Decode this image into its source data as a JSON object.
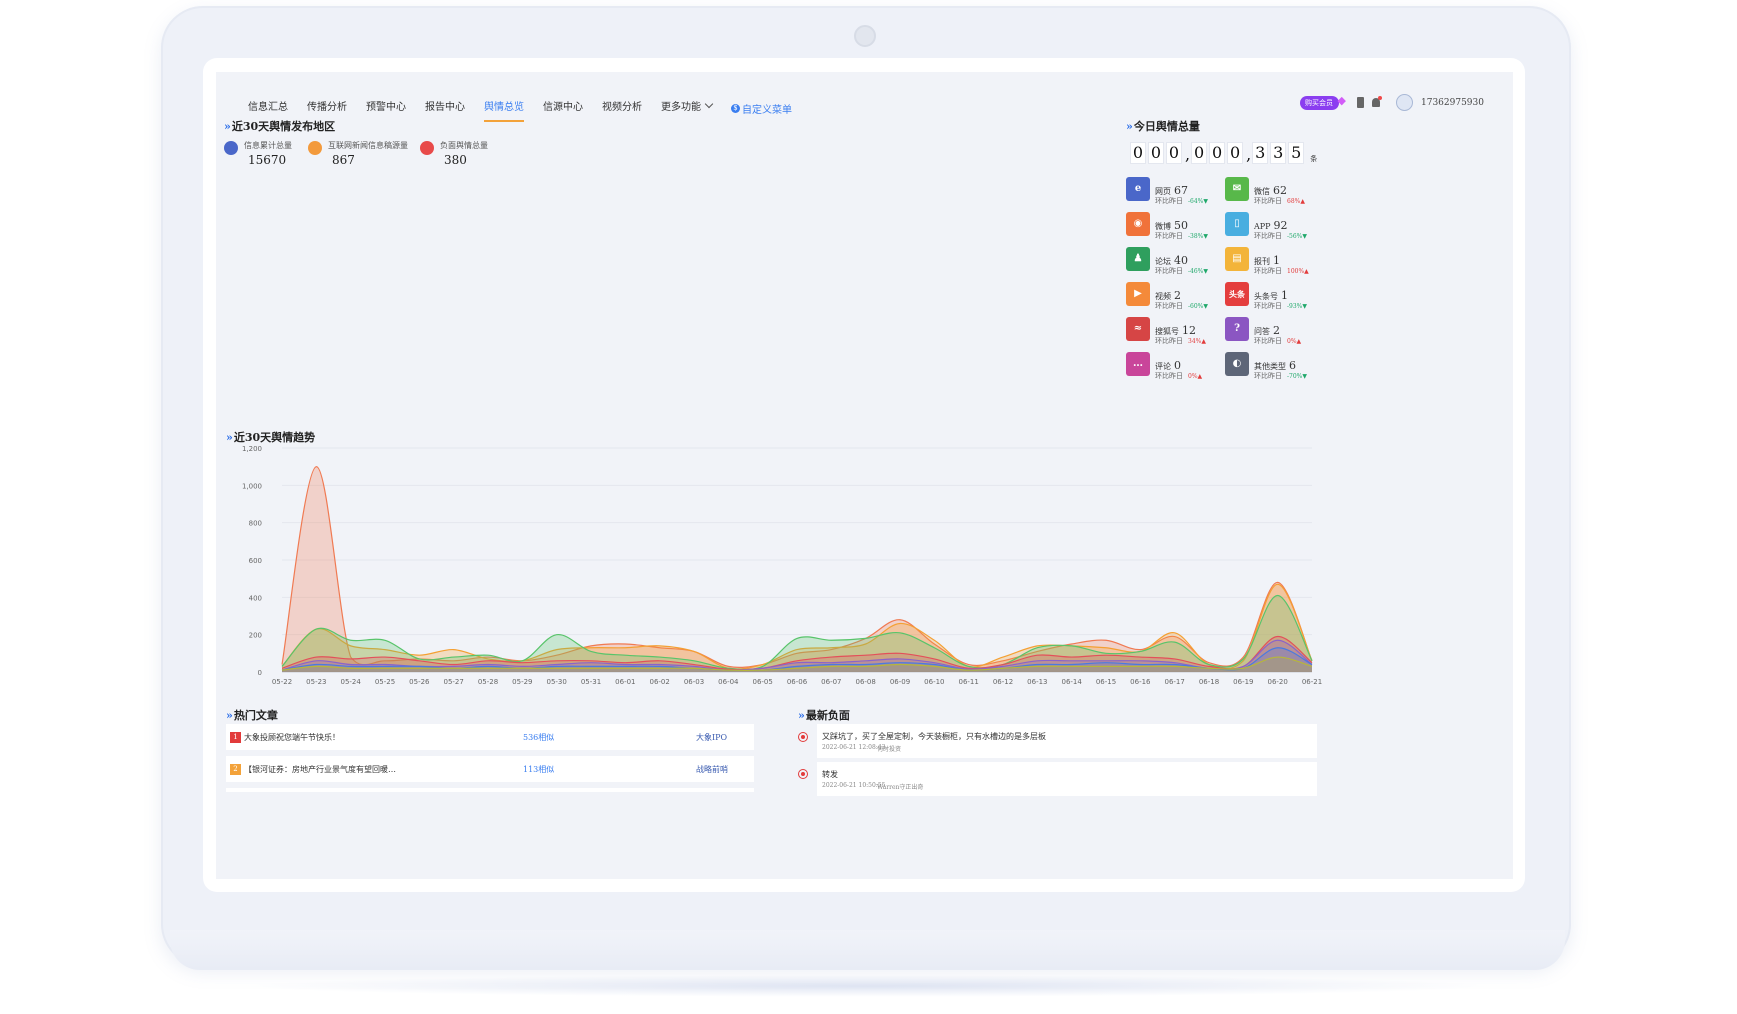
{
  "nav": {
    "items": [
      {
        "label": "信息汇总"
      },
      {
        "label": "传播分析"
      },
      {
        "label": "预警中心"
      },
      {
        "label": "报告中心"
      },
      {
        "label": "舆情总览",
        "active": true
      },
      {
        "label": "信源中心"
      },
      {
        "label": "视频分析"
      },
      {
        "label": "更多功能"
      }
    ],
    "custom_menu": "自定义菜单",
    "custom_menu_icon": "$"
  },
  "topbar": {
    "vip_label": "购买会员",
    "phone": "17362975930"
  },
  "region": {
    "title": "近30天舆情发布地区",
    "stats": [
      {
        "label": "信息累计总量",
        "value": "15670",
        "color": "#4a67c9"
      },
      {
        "label": "互联网新闻信息稿源量",
        "value": "867",
        "color": "#f39a3c"
      },
      {
        "label": "负面舆情总量",
        "value": "380",
        "color": "#e84a4a"
      }
    ]
  },
  "today": {
    "title": "今日舆情总量",
    "digits": [
      "0",
      "0",
      "0",
      ",",
      "0",
      "0",
      "0",
      ",",
      "3",
      "3",
      "5"
    ],
    "unit": "条",
    "compare_label": "环比昨日",
    "media": [
      {
        "name": "网页",
        "count": "67",
        "pct": "-64%",
        "dir": "down",
        "color": "#4a67c9",
        "icon": "e"
      },
      {
        "name": "微信",
        "count": "62",
        "pct": "68%",
        "dir": "up",
        "color": "#58b84a",
        "icon": "✉"
      },
      {
        "name": "微博",
        "count": "50",
        "pct": "-38%",
        "dir": "down",
        "color": "#f0723a",
        "icon": "◉"
      },
      {
        "name": "APP",
        "count": "92",
        "pct": "-56%",
        "dir": "down",
        "color": "#49aee0",
        "icon": "▯"
      },
      {
        "name": "论坛",
        "count": "40",
        "pct": "-46%",
        "dir": "down",
        "color": "#2f9f5e",
        "icon": "♟"
      },
      {
        "name": "报刊",
        "count": "1",
        "pct": "100%",
        "dir": "up",
        "color": "#f3b43a",
        "icon": "▤"
      },
      {
        "name": "视频",
        "count": "2",
        "pct": "-60%",
        "dir": "down",
        "color": "#f48a3a",
        "icon": "▶"
      },
      {
        "name": "头条号",
        "count": "1",
        "pct": "-93%",
        "dir": "down",
        "color": "#e43e3e",
        "icon": "头条"
      },
      {
        "name": "搜狐号",
        "count": "12",
        "pct": "34%",
        "dir": "up",
        "color": "#d64545",
        "icon": "≈"
      },
      {
        "name": "问答",
        "count": "2",
        "pct": "0%",
        "dir": "up",
        "color": "#8b56c2",
        "icon": "?"
      },
      {
        "name": "评论",
        "count": "0",
        "pct": "0%",
        "dir": "up",
        "color": "#c9459a",
        "icon": "…"
      },
      {
        "name": "其他类型",
        "count": "6",
        "pct": "-70%",
        "dir": "down",
        "color": "#5e6678",
        "icon": "◐"
      }
    ]
  },
  "trend": {
    "title": "近30天舆情趋势"
  },
  "chart_data": {
    "type": "area",
    "ylim": [
      0,
      1200
    ],
    "yticks": [
      "0",
      "200",
      "400",
      "600",
      "800",
      "1,000",
      "1,200"
    ],
    "categories": [
      "05-22",
      "05-23",
      "05-24",
      "05-25",
      "05-26",
      "05-27",
      "05-28",
      "05-29",
      "05-30",
      "05-31",
      "06-01",
      "06-02",
      "06-03",
      "06-04",
      "06-05",
      "06-06",
      "06-07",
      "06-08",
      "06-09",
      "06-10",
      "06-11",
      "06-12",
      "06-13",
      "06-14",
      "06-15",
      "06-16",
      "06-17",
      "06-18",
      "06-19",
      "06-20",
      "06-21"
    ],
    "series": [
      {
        "color": "#f07a52",
        "values": [
          40,
          1100,
          80,
          60,
          70,
          60,
          80,
          60,
          90,
          140,
          150,
          130,
          110,
          30,
          40,
          100,
          120,
          180,
          280,
          150,
          40,
          60,
          110,
          150,
          170,
          120,
          190,
          50,
          80,
          480,
          60
        ]
      },
      {
        "color": "#f4a033",
        "values": [
          30,
          230,
          140,
          120,
          90,
          120,
          70,
          60,
          120,
          130,
          130,
          140,
          110,
          20,
          40,
          120,
          130,
          150,
          260,
          170,
          30,
          80,
          140,
          140,
          130,
          110,
          210,
          40,
          60,
          470,
          60
        ]
      },
      {
        "color": "#58c46a",
        "values": [
          30,
          230,
          170,
          170,
          70,
          80,
          90,
          60,
          200,
          110,
          90,
          80,
          60,
          20,
          30,
          180,
          170,
          180,
          210,
          130,
          30,
          40,
          130,
          140,
          100,
          110,
          160,
          40,
          70,
          410,
          60
        ]
      },
      {
        "color": "#e3505a",
        "values": [
          20,
          80,
          70,
          80,
          60,
          40,
          60,
          50,
          60,
          60,
          50,
          60,
          40,
          15,
          20,
          60,
          80,
          90,
          100,
          70,
          20,
          40,
          90,
          80,
          90,
          80,
          70,
          30,
          30,
          190,
          50
        ]
      },
      {
        "color": "#8b63c9",
        "values": [
          10,
          60,
          40,
          40,
          30,
          30,
          40,
          30,
          40,
          50,
          40,
          40,
          30,
          10,
          20,
          50,
          50,
          60,
          70,
          50,
          15,
          30,
          60,
          60,
          60,
          60,
          50,
          20,
          30,
          170,
          40
        ]
      },
      {
        "color": "#4a7ae0",
        "values": [
          10,
          40,
          30,
          30,
          30,
          20,
          30,
          20,
          30,
          30,
          30,
          30,
          20,
          10,
          10,
          30,
          40,
          40,
          50,
          40,
          10,
          20,
          40,
          40,
          50,
          40,
          40,
          20,
          20,
          130,
          40
        ]
      },
      {
        "color": "#b7b63a",
        "values": [
          10,
          30,
          20,
          20,
          20,
          20,
          20,
          20,
          20,
          20,
          20,
          20,
          20,
          10,
          10,
          20,
          30,
          30,
          40,
          30,
          10,
          20,
          30,
          30,
          30,
          30,
          30,
          20,
          20,
          80,
          30
        ]
      }
    ]
  },
  "hot": {
    "title": "热门文章",
    "items": [
      {
        "rank": "1",
        "rank_color": "#e23b3b",
        "title": "大象投顾祝您端午节快乐！",
        "similar": "536相似",
        "source": "大象IPO"
      },
      {
        "rank": "2",
        "rank_color": "#f3a23a",
        "title": "【银河证券：房地产行业景气度有望回暖…",
        "similar": "113相似",
        "source": "战略前哨"
      }
    ]
  },
  "negative": {
    "title": "最新负面",
    "items": [
      {
        "title": "又踩坑了，买了全屋定制，今天装橱柜，只有水槽边的是多层板",
        "time": "2022-06-21 12:08:43",
        "author": "何时投资"
      },
      {
        "title": "转发",
        "time": "2022-06-21 10:50:55",
        "author": "Warren守正出奇"
      }
    ]
  }
}
